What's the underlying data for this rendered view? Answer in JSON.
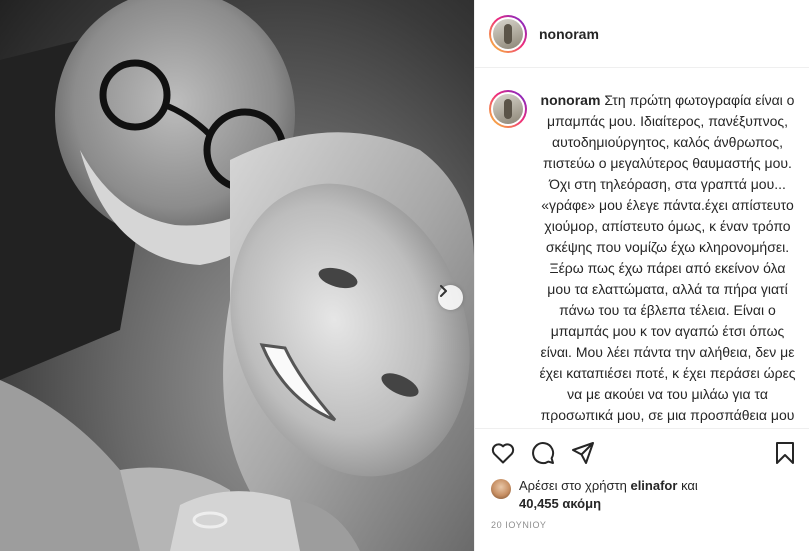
{
  "post": {
    "username": "nonoram",
    "caption": "Στη πρώτη φωτογραφία είναι ο μπαμπάς μου. Ιδιαίτερος, πανέξυπνος, αυτοδημιούργητος, καλός άνθρωπος, πιστεύω ο μεγαλύτερος θαυμαστής μου. Όχι στη τηλεόραση, στα γραπτά μου... «γράφε» μου έλεγε πάντα.έχει απίστευτο χιούμορ, απίστευτο όμως, κ έναν τρόπο σκέψης που νομίζω έχω κληρονομήσει. Ξέρω πως έχω πάρει από εκείνον όλα μου τα ελαττώματα, αλλά τα πήρα γιατί πάνω του τα έβλεπα τέλεια. Είναι ο μπαμπάς μου κ τον αγαπώ έτσι όπως είναι. Μου λέει πάντα την αλήθεια, δεν με έχει καταπιέσει ποτέ, κ έχει περάσει ώρες να με ακούει να του μιλάω για τα προσωπικά μου, σε μια προσπάθεια μου να μάθω τις",
    "likes_prefix": "Αρέσει στο χρήστη",
    "liked_by": "elinafor",
    "likes_conjunction": "και",
    "likes_count": "40,455 ακόμη",
    "date": "20 ΙΟΥΝΙΟΥ"
  },
  "icons": {
    "like": "heart-icon",
    "comment": "comment-bubble-icon",
    "share": "paper-plane-icon",
    "save": "bookmark-icon",
    "next": "chevron-right-icon"
  },
  "colors": {
    "text": "#262626",
    "muted": "#8e8e8e",
    "divider": "#efefef"
  }
}
